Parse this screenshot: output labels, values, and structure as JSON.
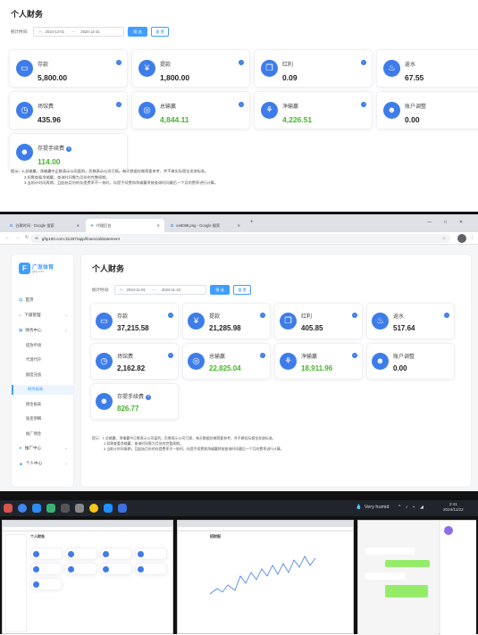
{
  "top": {
    "title": "个人财务",
    "filter_label": "统计时间:",
    "date_start": "2024-12-01",
    "date_sep": "—",
    "date_end": "2024-12-31",
    "btn_filter": "筛 选",
    "btn_reset": "重 置",
    "cards": [
      {
        "label": "存款",
        "value": "5,800.00",
        "green": false
      },
      {
        "label": "提款",
        "value": "1,800.00",
        "green": false
      },
      {
        "label": "红利",
        "value": "0.09",
        "green": false
      },
      {
        "label": "返水",
        "value": "67.55",
        "green": false
      },
      {
        "label": "场馆费",
        "value": "435.96",
        "green": false
      },
      {
        "label": "总输赢",
        "value": "4,844.11",
        "green": true
      },
      {
        "label": "净输赢",
        "value": "4,226.51",
        "green": true
      },
      {
        "label": "账户调整",
        "value": "0.00",
        "green": false
      },
      {
        "label": "存提手续费",
        "value": "114.00",
        "green": true
      }
    ],
    "notes_title": "提示：",
    "notes": [
      "1.总输赢、净输赢中正数表示公司盈利，负数表示公司亏损，每天数据仅做简要参考，并不做实际佣金发放标准。",
      "2.如需查看净输赢，查询时间需为月份的完整周期。",
      "3.当前计时间周期，且起始月份的存提费率不一致时，存提手续费和净输赢将按查询时间最后一个月的费率进行计算。"
    ]
  },
  "browser": {
    "tabs": [
      {
        "label": "谷歌时间 - Google 搜索"
      },
      {
        "label": "代理后台"
      },
      {
        "label": "ee8098.png - Google 搜索"
      }
    ],
    "new_tab": "+",
    "address": "gfty100.com:31337/app/financialStatement",
    "window_controls": [
      "—",
      "□",
      "✕"
    ],
    "logo_text": "广发体育",
    "logo_sub": "gfty.com",
    "nav": [
      {
        "label": "首页",
        "type": "item"
      },
      {
        "label": "下级管理",
        "type": "group"
      },
      {
        "label": "财务中心",
        "type": "group"
      },
      {
        "label": "提款申请",
        "type": "sub"
      },
      {
        "label": "代理代存",
        "type": "sub"
      },
      {
        "label": "额度充值",
        "type": "sub"
      },
      {
        "label": "财务报表",
        "type": "sub-active"
      },
      {
        "label": "佣金报表",
        "type": "sub"
      },
      {
        "label": "账变明细",
        "type": "sub"
      },
      {
        "label": "推广佣金",
        "type": "sub"
      },
      {
        "label": "推广中心",
        "type": "group"
      },
      {
        "label": "个人中心",
        "type": "group"
      }
    ],
    "title": "个人财务",
    "filter_label": "统计时间:",
    "date_start": "2024-11-01",
    "date_sep": "—",
    "date_end": "2024-11-22",
    "btn_filter": "筛 选",
    "btn_reset": "重 置",
    "cards": [
      {
        "label": "存款",
        "value": "37,215.58",
        "green": false
      },
      {
        "label": "提款",
        "value": "21,285.98",
        "green": false
      },
      {
        "label": "红利",
        "value": "405.85",
        "green": false
      },
      {
        "label": "返水",
        "value": "517.64",
        "green": false
      },
      {
        "label": "场馆费",
        "value": "2,162.82",
        "green": false
      },
      {
        "label": "总输赢",
        "value": "22,825.04",
        "green": true
      },
      {
        "label": "净输赢",
        "value": "18,911.96",
        "green": true
      },
      {
        "label": "账户调整",
        "value": "0.00",
        "green": false
      },
      {
        "label": "存提手续费",
        "value": "826.77",
        "green": true
      }
    ],
    "notes_title": "提示：",
    "notes": [
      "1.总输赢、净输赢中正数表示公司盈利，负数表示公司亏损，每天数据仅做简要参考，并不做实际佣金发放标准。",
      "2.如需查看净输赢，查询时间需为月份的完整周期。",
      "3.当前计时间周期，且起始月份的存提费率不一致时，存提手续费和净输赢将按查询时间最后一个月的费率进行计算。"
    ]
  },
  "taskbar": {
    "weather": "Very humid",
    "time": "2:41",
    "date": "2024/11/22"
  },
  "thumbs": {
    "t1_title": "个人财务",
    "t2_title": "招财报"
  }
}
